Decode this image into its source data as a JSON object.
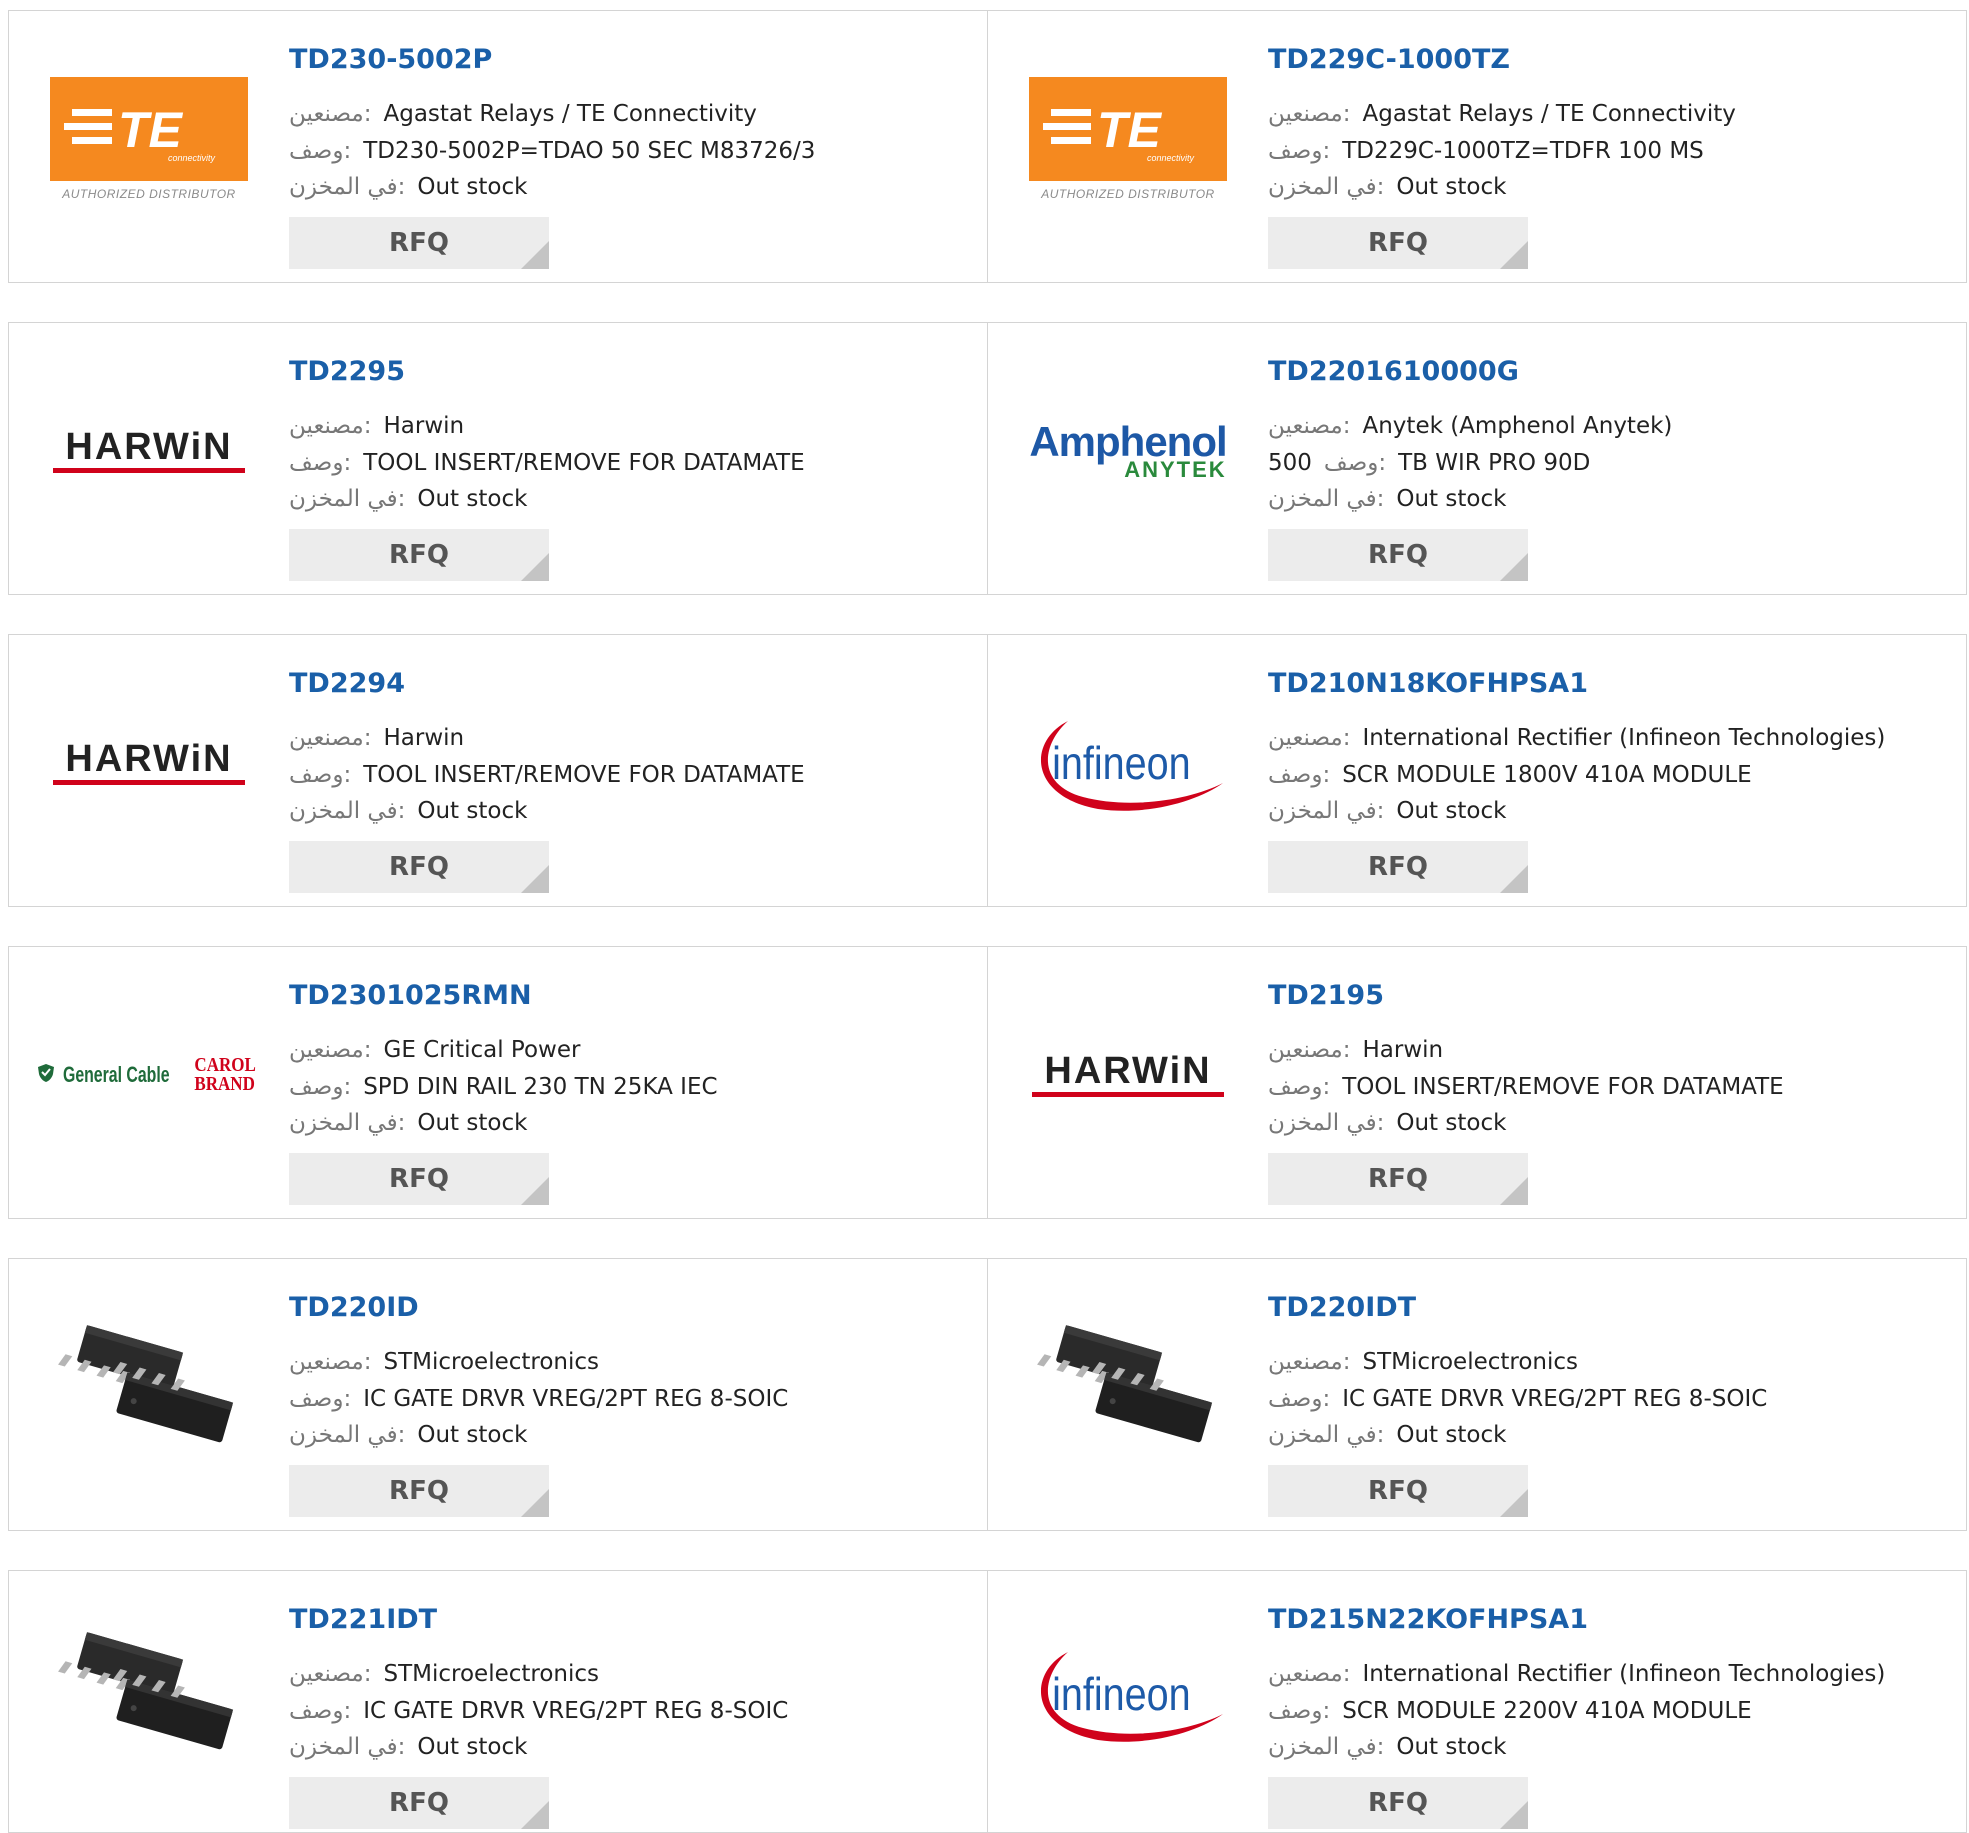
{
  "labels": {
    "manufacturer": "مصنعين:",
    "description": "وصف:",
    "stock": "في المخزن:",
    "rfq": "RFQ"
  },
  "logo_texts": {
    "te_sub": "AUTHORIZED DISTRIBUTOR",
    "te_brand": "TE",
    "te_connectivity": "connectivity",
    "harwin": "HARWiN",
    "amphenol": "Amphenol",
    "anytek": "ANYTEK",
    "infineon": "infineon",
    "general_cable": "General Cable",
    "carol_line1": "CAROL",
    "carol_line2": "BRAND"
  },
  "colors": {
    "part_link": "#1a5fa8",
    "te_orange": "#f5891f",
    "harwin_red": "#d0021b",
    "amphenol_blue": "#1d58a6",
    "anytek_green": "#2a8a3c",
    "infineon_blue": "#1d5aa8",
    "infineon_red": "#d0021b"
  },
  "products": [
    {
      "part": "TD230-5002P",
      "manufacturer": "Agastat Relays / TE Connectivity",
      "description": "TD230-5002P=TDAO 50 SEC M83726/3",
      "stock": "Out stock",
      "logo": "te-connectivity-logo"
    },
    {
      "part": "TD229C-1000TZ",
      "manufacturer": "Agastat Relays / TE Connectivity",
      "description": "TD229C-1000TZ=TDFR 100 MS",
      "stock": "Out stock",
      "logo": "te-connectivity-logo"
    },
    {
      "part": "TD2295",
      "manufacturer": "Harwin",
      "description": "TOOL INSERT/REMOVE FOR DATAMATE",
      "stock": "Out stock",
      "logo": "harwin-logo"
    },
    {
      "part": "TD2201610000G",
      "manufacturer": "Anytek (Amphenol Anytek)",
      "description": "TB WIR PRO 90D",
      "description_prefix": "500",
      "stock": "Out stock",
      "logo": "amphenol-anytek-logo"
    },
    {
      "part": "TD2294",
      "manufacturer": "Harwin",
      "description": "TOOL INSERT/REMOVE FOR DATAMATE",
      "stock": "Out stock",
      "logo": "harwin-logo"
    },
    {
      "part": "TD210N18KOFHPSA1",
      "manufacturer": "International Rectifier (Infineon Technologies)",
      "description": "SCR MODULE 1800V 410A MODULE",
      "stock": "Out stock",
      "logo": "infineon-logo"
    },
    {
      "part": "TD2301025RMN",
      "manufacturer": "GE Critical Power",
      "description": "SPD DIN RAIL 230 TN 25KA IEC",
      "stock": "Out stock",
      "logo": "general-cable-carol-logo"
    },
    {
      "part": "TD2195",
      "manufacturer": "Harwin",
      "description": "TOOL INSERT/REMOVE FOR DATAMATE",
      "stock": "Out stock",
      "logo": "harwin-logo"
    },
    {
      "part": "TD220ID",
      "manufacturer": "STMicroelectronics",
      "description": "IC GATE DRVR VREG/2PT REG 8-SOIC",
      "stock": "Out stock",
      "logo": "soic-chip-image"
    },
    {
      "part": "TD220IDT",
      "manufacturer": "STMicroelectronics",
      "description": "IC GATE DRVR VREG/2PT REG 8-SOIC",
      "stock": "Out stock",
      "logo": "soic-chip-image"
    },
    {
      "part": "TD221IDT",
      "manufacturer": "STMicroelectronics",
      "description": "IC GATE DRVR VREG/2PT REG 8-SOIC",
      "stock": "Out stock",
      "logo": "soic-chip-image"
    },
    {
      "part": "TD215N22KOFHPSA1",
      "manufacturer": "International Rectifier (Infineon Technologies)",
      "description": "SCR MODULE 2200V 410A MODULE",
      "stock": "Out stock",
      "logo": "infineon-logo"
    }
  ]
}
